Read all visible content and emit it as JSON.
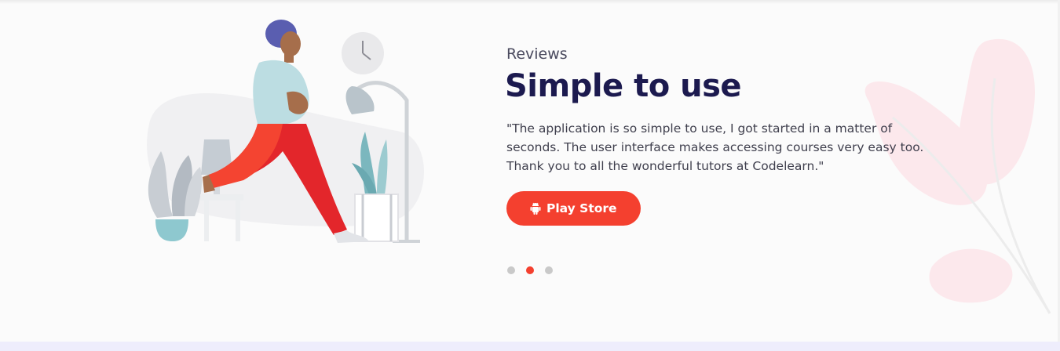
{
  "testimonial": {
    "eyebrow": "Reviews",
    "title": "Simple to use",
    "quote": "\"The application is so simple to use, I got started in a matter of seconds. The user interface makes accessing courses very easy too. Thank you to all the wonderful tutors at Codelearn.\"",
    "cta_label": "Play Store",
    "cta_icon": "android-icon"
  },
  "carousel": {
    "slide_count": 3,
    "active_index": 1
  },
  "colors": {
    "accent": "#f4402f",
    "title": "#1c1a4f",
    "background": "#fbfbfb",
    "bottom_band": "#eeedfc"
  }
}
